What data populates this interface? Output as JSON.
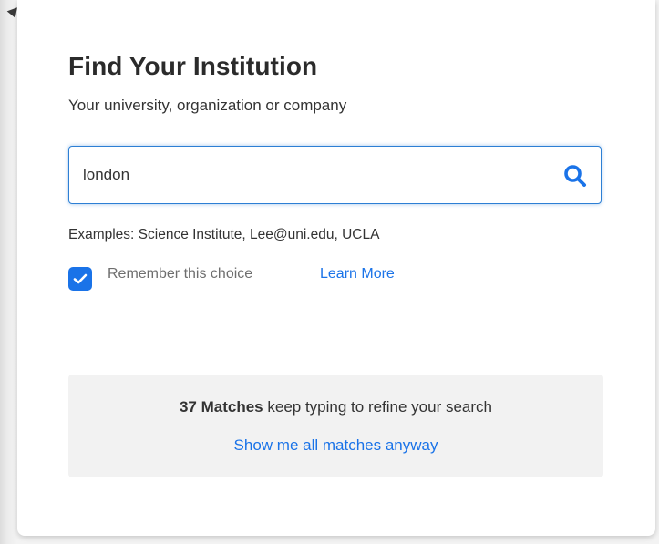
{
  "header": {
    "title": "Find Your Institution",
    "subtitle": "Your university, organization or company"
  },
  "search": {
    "value": "london",
    "placeholder": "",
    "icon": "search-icon"
  },
  "examples_text": "Examples: Science Institute, Lee@uni.edu, UCLA",
  "remember": {
    "checked": true,
    "label": "Remember this choice",
    "learn_more": "Learn More"
  },
  "results": {
    "count_label": "37 Matches",
    "hint": " keep typing to refine your search",
    "show_all": "Show me all matches anyway"
  },
  "colors": {
    "accent": "#1a73e8",
    "focus_border": "#2d7fd4",
    "title_text": "#2b2b2b",
    "results_bg": "#f2f2f2"
  }
}
